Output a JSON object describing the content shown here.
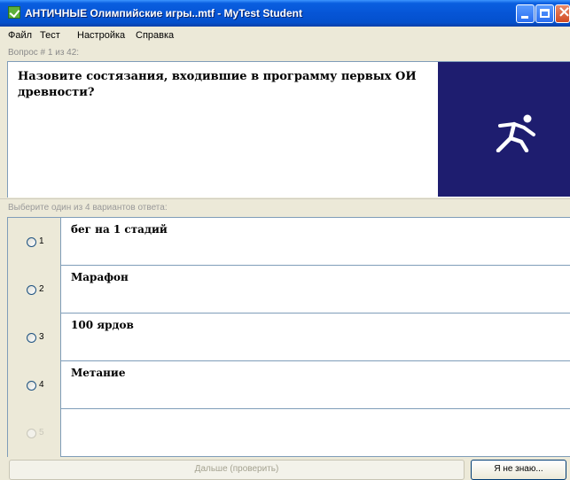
{
  "window": {
    "title": "АНТИЧНЫЕ Олимпийские игры..mtf - MyTest Student"
  },
  "menu": [
    "Файл",
    "Тест",
    "Настройка",
    "Справка"
  ],
  "question": {
    "counter": "Вопрос # 1 из 42:",
    "text": "Назовите состязания, входившие в программу первых ОИ древности?",
    "image_icon": "runner-icon",
    "image_bg": "#1e1d6f"
  },
  "answers": {
    "hint": "Выберите один из 4 вариантов ответа:",
    "options": [
      {
        "number": "1",
        "text": "бег на 1 стадий"
      },
      {
        "number": "2",
        "text": "Марафон"
      },
      {
        "number": "3",
        "text": "100 ярдов"
      },
      {
        "number": "4",
        "text": "Метание"
      },
      {
        "number": "5",
        "text": ""
      }
    ]
  },
  "buttons": {
    "next": "Дальше (проверить)",
    "dont_know": "Я не знаю..."
  }
}
